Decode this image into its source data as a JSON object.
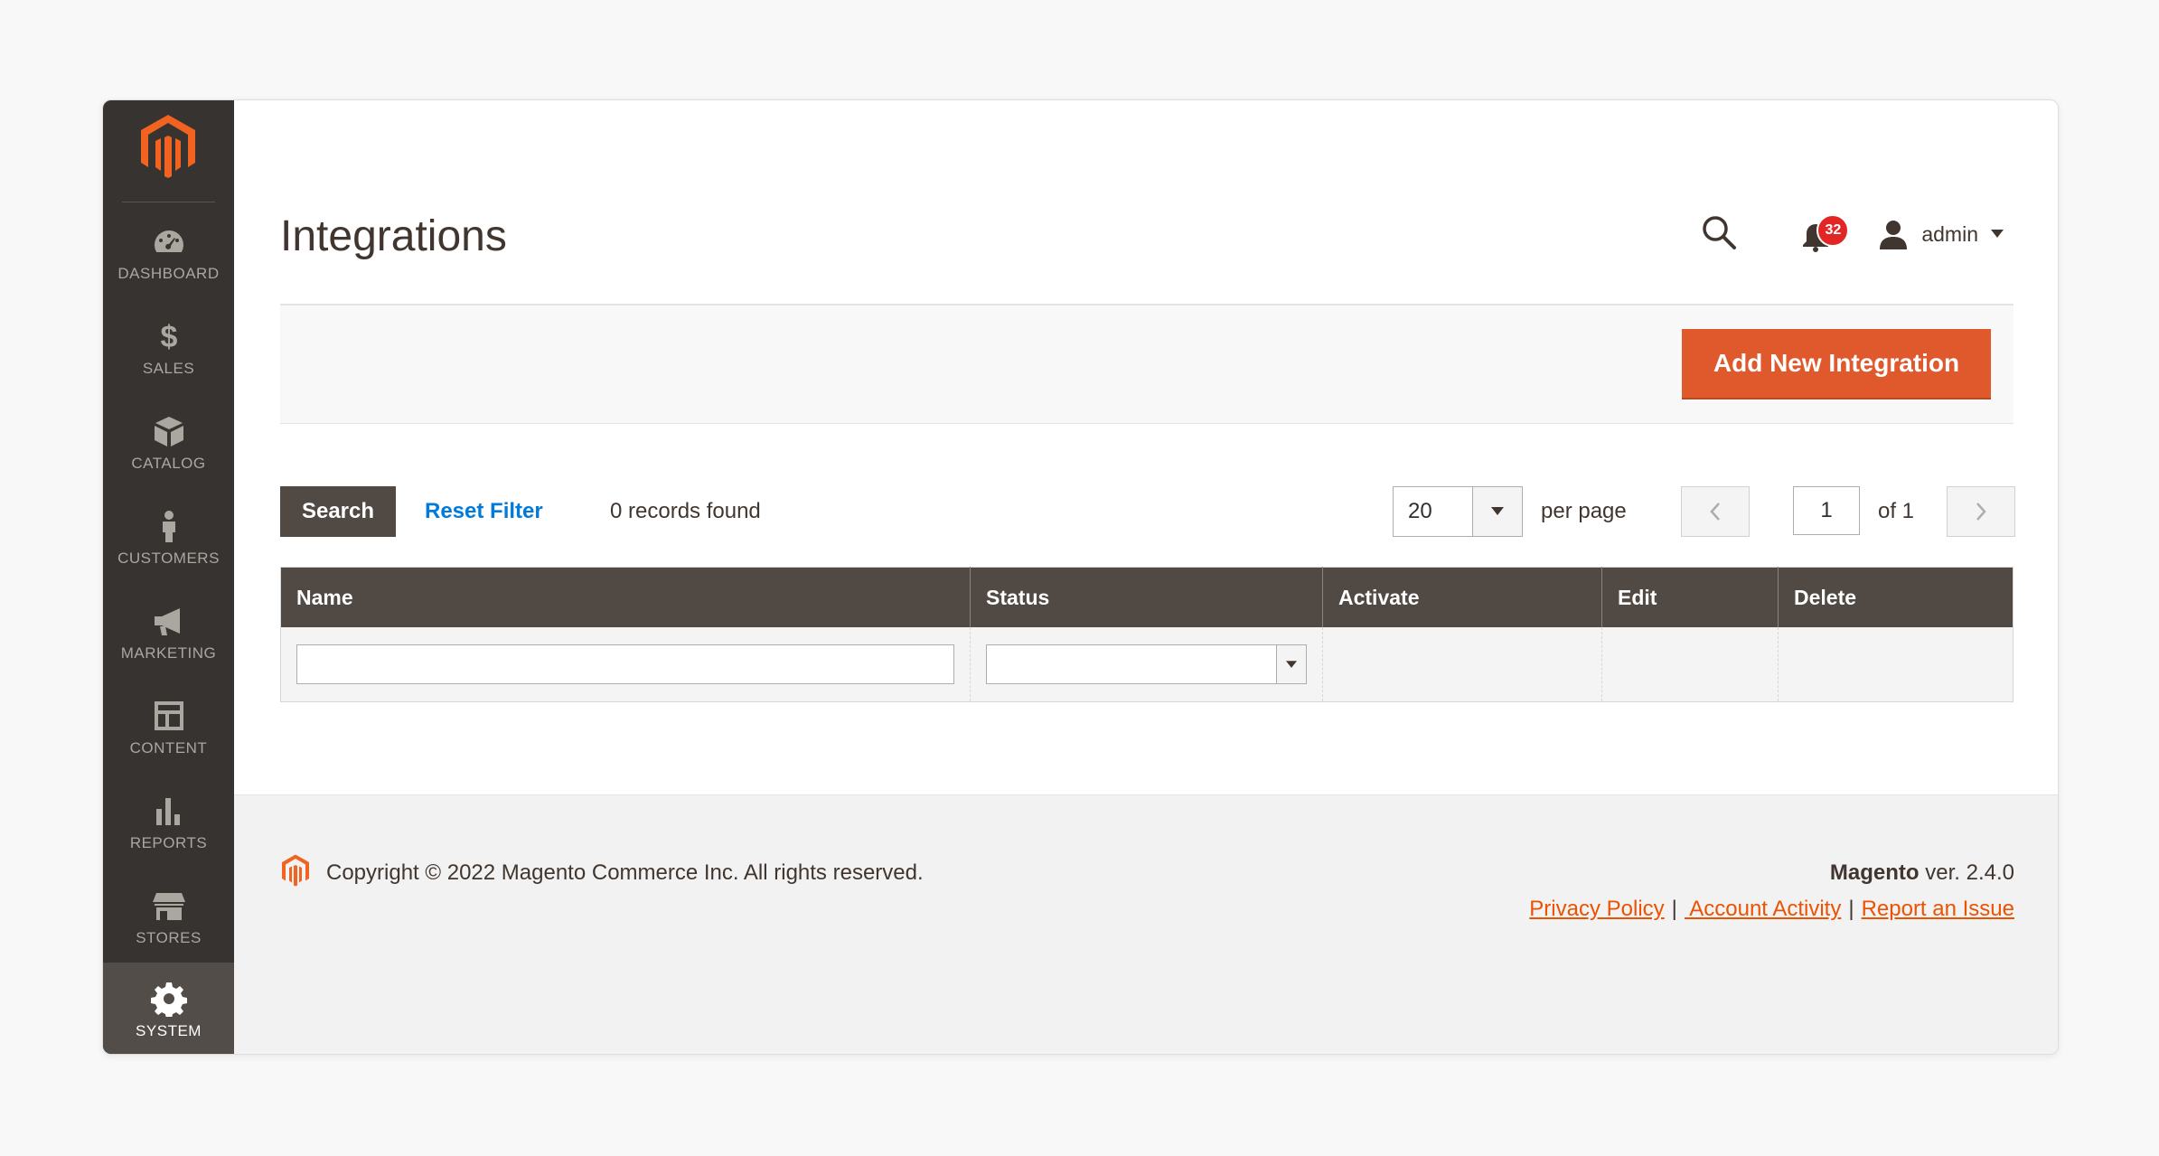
{
  "sidebar": {
    "logo": "magento-logo",
    "items": [
      {
        "label": "DASHBOARD",
        "icon": "speedometer-icon"
      },
      {
        "label": "SALES",
        "icon": "dollar-icon"
      },
      {
        "label": "CATALOG",
        "icon": "box-icon"
      },
      {
        "label": "CUSTOMERS",
        "icon": "person-icon"
      },
      {
        "label": "MARKETING",
        "icon": "megaphone-icon"
      },
      {
        "label": "CONTENT",
        "icon": "layout-icon"
      },
      {
        "label": "REPORTS",
        "icon": "bar-chart-icon"
      },
      {
        "label": "STORES",
        "icon": "storefront-icon"
      },
      {
        "label": "SYSTEM",
        "icon": "gear-icon",
        "active": true
      }
    ]
  },
  "header": {
    "title": "Integrations",
    "notification_count": "32",
    "user_name": "admin"
  },
  "actions": {
    "add_label": "Add New Integration"
  },
  "toolbar": {
    "search_label": "Search",
    "reset_label": "Reset Filter",
    "records_text": "0 records found",
    "per_page_value": "20",
    "per_page_label": "per page",
    "current_page": "1",
    "page_of": "of 1"
  },
  "grid": {
    "columns": [
      "Name",
      "Status",
      "Activate",
      "Edit",
      "Delete"
    ]
  },
  "footer": {
    "copyright": "Copyright © 2022 Magento Commerce Inc. All rights reserved.",
    "brand": "Magento",
    "version": " ver. 2.4.0",
    "links": [
      "Privacy Policy",
      " Account Activity",
      "Report an Issue"
    ],
    "separator": "|"
  },
  "colors": {
    "sidebar_bg": "#373330",
    "accent": "#e0592c",
    "link": "#007bdb",
    "footer_link": "#eb5202",
    "table_header": "#514943"
  }
}
